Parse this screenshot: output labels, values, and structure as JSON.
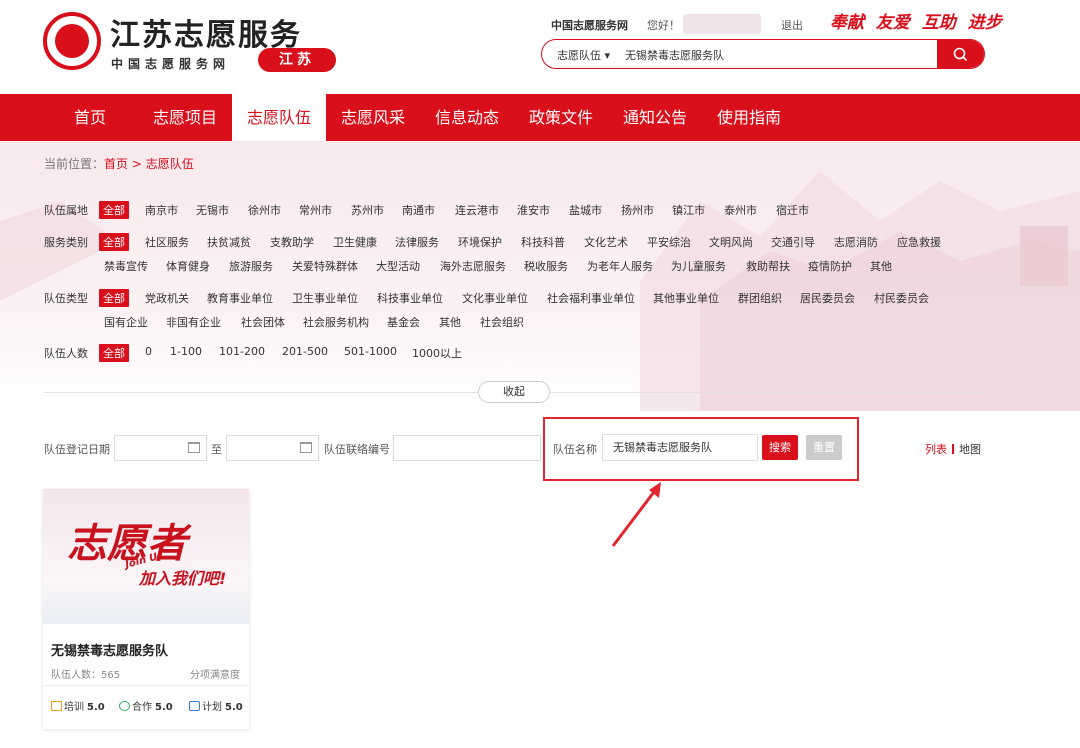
{
  "header": {
    "logo_title": "江苏志愿服务",
    "logo_sub": "中国志愿服务网",
    "logo_province": "江苏",
    "site_name": "中国志愿服务网",
    "greeting": "您好！",
    "logout": "退出",
    "slogan": "奉献 友爱 互助 进步",
    "search": {
      "scope": "志愿队伍 ▾",
      "value": "无锡禁毒志愿服务队"
    }
  },
  "nav": {
    "items": [
      {
        "label": "首页"
      },
      {
        "label": "志愿项目"
      },
      {
        "label": "志愿队伍",
        "active": true
      },
      {
        "label": "志愿风采"
      },
      {
        "label": "信息动态"
      },
      {
        "label": "政策文件"
      },
      {
        "label": "通知公告"
      },
      {
        "label": "使用指南"
      }
    ]
  },
  "breadcrumb": {
    "prefix": "当前位置：",
    "home": "首页",
    "sep": " > ",
    "current": "志愿队伍"
  },
  "filters": {
    "region": {
      "label": "队伍属地",
      "options": [
        "全部",
        "南京市",
        "无锡市",
        "徐州市",
        "常州市",
        "苏州市",
        "南通市",
        "连云港市",
        "淮安市",
        "盐城市",
        "扬州市",
        "镇江市",
        "泰州市",
        "宿迁市"
      ]
    },
    "service": {
      "label": "服务类别",
      "options_row1": [
        "全部",
        "社区服务",
        "扶贫减贫",
        "支教助学",
        "卫生健康",
        "法律服务",
        "环境保护",
        "科技科普",
        "文化艺术",
        "平安综治",
        "文明风尚",
        "交通引导",
        "志愿消防",
        "应急救援"
      ],
      "options_row2": [
        "禁毒宣传",
        "体育健身",
        "旅游服务",
        "关爱特殊群体",
        "大型活动",
        "海外志愿服务",
        "税收服务",
        "为老年人服务",
        "为儿童服务",
        "救助帮扶",
        "疫情防护",
        "其他"
      ]
    },
    "type": {
      "label": "队伍类型",
      "options_row1": [
        "全部",
        "党政机关",
        "教育事业单位",
        "卫生事业单位",
        "科技事业单位",
        "文化事业单位",
        "社会福利事业单位",
        "其他事业单位",
        "群团组织",
        "居民委员会",
        "村民委员会"
      ],
      "options_row2": [
        "国有企业",
        "非国有企业",
        "社会团体",
        "社会服务机构",
        "基金会",
        "其他",
        "社会组织"
      ]
    },
    "size": {
      "label": "队伍人数",
      "options": [
        "全部",
        "0",
        "1-100",
        "101-200",
        "201-500",
        "501-1000",
        "1000以上"
      ]
    },
    "collapse": "收起"
  },
  "query": {
    "date_label": "队伍登记日期",
    "to_label": "至",
    "contact_label": "队伍联络编号",
    "name_label": "队伍名称",
    "name_value": "无锡禁毒志愿服务队",
    "search_btn": "搜索",
    "reset_btn": "重置",
    "view_list": "列表",
    "view_map": "地图"
  },
  "card": {
    "image_text": "志愿者",
    "image_joinus": "Join Us",
    "image_slogan": "加入我们吧!",
    "title": "无锡禁毒志愿服务队",
    "count": "队伍人数：565",
    "classification": "分项满意度",
    "stats": [
      {
        "label": "培训",
        "value": "5.0",
        "icon": "training-icon",
        "color": "#f0a020"
      },
      {
        "label": "合作",
        "value": "5.0",
        "icon": "cooperation-icon",
        "color": "#3cb46e"
      },
      {
        "label": "计划",
        "value": "5.0",
        "icon": "plan-icon",
        "color": "#3a7bd5"
      }
    ]
  },
  "colors": {
    "brand": "#d90f1c",
    "annotation": "#e3262d"
  }
}
